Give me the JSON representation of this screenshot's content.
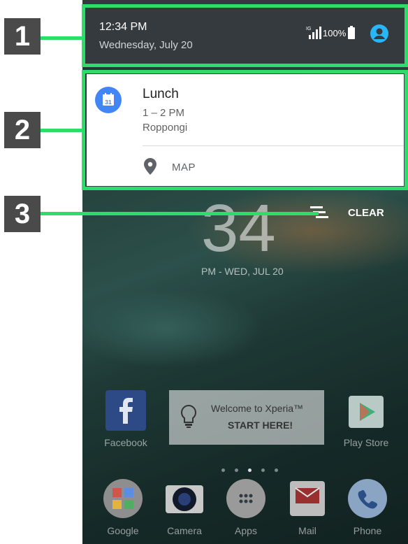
{
  "status_bar": {
    "time": "12:34 PM",
    "date": "Wednesday, July 20",
    "signal_badge": "IG",
    "battery": "100%"
  },
  "notification": {
    "calendar_day": "31",
    "title": "Lunch",
    "time_range": "1 – 2 PM",
    "location": "Roppongi",
    "action_label": "MAP"
  },
  "clear_label": "CLEAR",
  "lockscreen": {
    "clock_digits": "34",
    "clock_sub": "PM - WED, JUL 20"
  },
  "welcome": {
    "line1": "Welcome to Xperia™",
    "line2": "START HERE!"
  },
  "apps_top": [
    {
      "label": "Facebook",
      "icon": "facebook-icon"
    },
    {
      "label": "Play Store",
      "icon": "play-store-icon"
    }
  ],
  "dock": [
    {
      "label": "Google",
      "icon": "google-icon"
    },
    {
      "label": "Camera",
      "icon": "camera-icon"
    },
    {
      "label": "Apps",
      "icon": "apps-icon"
    },
    {
      "label": "Mail",
      "icon": "mail-icon"
    },
    {
      "label": "Phone",
      "icon": "phone-icon"
    }
  ],
  "callouts": [
    "1",
    "2",
    "3"
  ],
  "colors": {
    "callout": "#2edc6a",
    "calendar": "#4285f4",
    "avatar": "#29b6f6"
  }
}
